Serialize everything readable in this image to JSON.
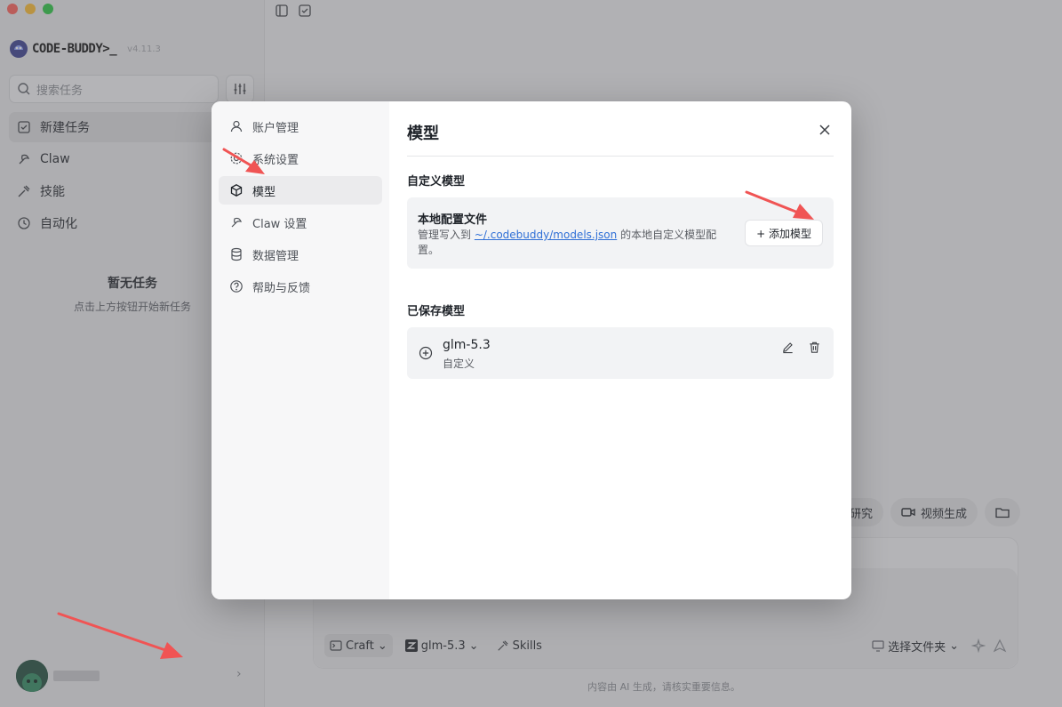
{
  "window": {
    "traffic_lights": [
      "close",
      "minimize",
      "maximize"
    ]
  },
  "sidebar": {
    "brand": "CODE-BUDDY>_",
    "version": "v4.11.3",
    "search": {
      "placeholder": "搜索任务"
    },
    "nav": [
      {
        "label": "新建任务",
        "icon": "new-task-icon",
        "active": true
      },
      {
        "label": "Claw",
        "icon": "claw-icon",
        "active": false
      },
      {
        "label": "技能",
        "icon": "skills-icon",
        "active": false
      },
      {
        "label": "自动化",
        "icon": "clock-icon",
        "active": false
      }
    ],
    "empty": {
      "title": "暂无任务",
      "subtitle": "点击上方按钮开始新任务"
    },
    "user": {
      "chevron": "›"
    }
  },
  "main": {
    "chips": [
      {
        "label": "研究",
        "icon": "research-icon"
      },
      {
        "label": "视频生成",
        "icon": "video-icon"
      },
      {
        "label": "",
        "icon": "folder-icon"
      }
    ],
    "composer": {
      "mode": "Craft",
      "model": "glm-5.3",
      "skills": "Skills",
      "folder": "选择文件夹"
    },
    "footer_note": "内容由 AI 生成，请核实重要信息。"
  },
  "modal": {
    "nav": [
      {
        "label": "账户管理",
        "icon": "user-icon",
        "active": false
      },
      {
        "label": "系统设置",
        "icon": "gear-icon",
        "active": false
      },
      {
        "label": "模型",
        "icon": "cube-icon",
        "active": true
      },
      {
        "label": "Claw 设置",
        "icon": "claw-icon",
        "active": false
      },
      {
        "label": "数据管理",
        "icon": "database-icon",
        "active": false
      },
      {
        "label": "帮助与反馈",
        "icon": "help-icon",
        "active": false
      }
    ],
    "title": "模型",
    "custom_section": {
      "label": "自定义模型",
      "card_title": "本地配置文件",
      "desc_prefix": "管理写入到 ",
      "desc_link": "~/.codebuddy/models.json",
      "desc_suffix": " 的本地自定义模型配置。",
      "add_button": "+ 添加模型"
    },
    "saved_section": {
      "label": "已保存模型",
      "models": [
        {
          "name": "glm-5.3",
          "type": "自定义"
        }
      ]
    }
  },
  "annotations": {
    "arrow_color": "#f05454"
  }
}
